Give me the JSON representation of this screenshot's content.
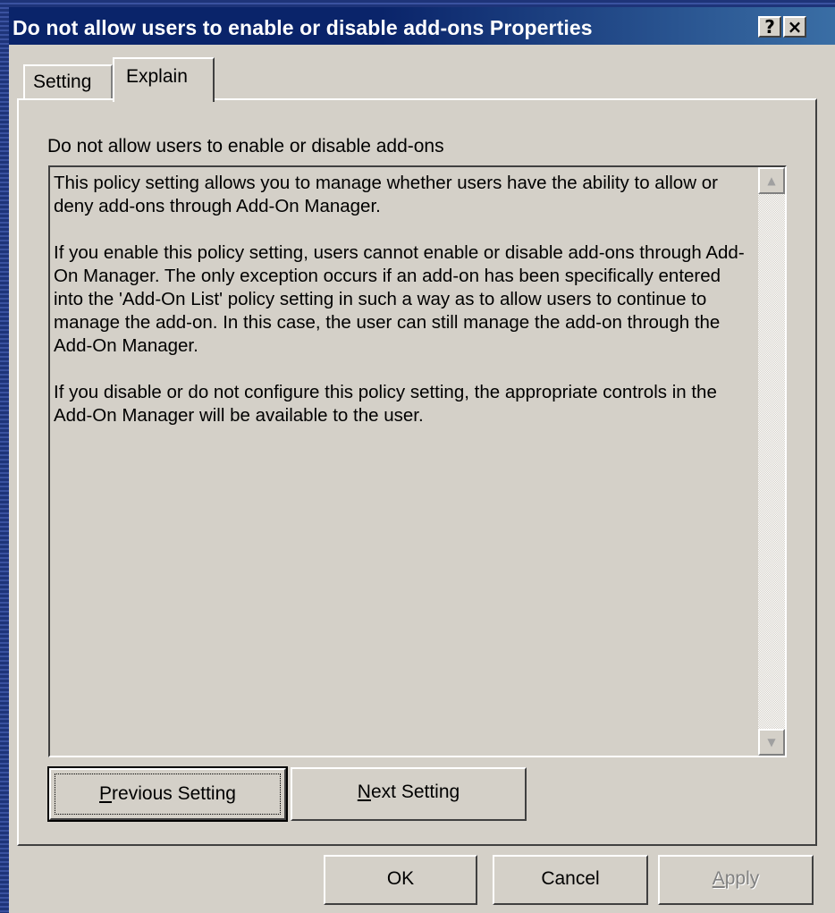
{
  "window": {
    "title": "Do not allow users to enable or disable add-ons Properties",
    "help_button": "?",
    "close_button": "×"
  },
  "tabs": [
    {
      "label": "Setting",
      "selected": false
    },
    {
      "label": "Explain",
      "selected": true
    }
  ],
  "explain": {
    "heading": "Do not allow users to enable or disable add-ons",
    "paragraphs": [
      "This policy setting allows you to manage whether users have the ability to allow or deny add-ons through Add-On Manager.",
      "If you enable this policy setting, users cannot enable or disable add-ons through Add-On Manager. The only exception occurs if an add-on has been specifically entered into the 'Add-On List' policy setting in such a way as to allow users to continue to manage the add-on. In this case, the user can still manage the add-on through the Add-On Manager.",
      "If you disable or do not configure this policy setting, the appropriate controls in the Add-On Manager will be available to the user."
    ]
  },
  "buttons": {
    "previous_setting": {
      "mnemonic": "P",
      "rest": "revious Setting"
    },
    "next_setting": {
      "mnemonic": "N",
      "rest": "ext Setting"
    },
    "ok": "OK",
    "cancel": "Cancel",
    "apply": {
      "mnemonic": "A",
      "rest": "pply",
      "enabled": false
    }
  },
  "icons": {
    "scroll_up": "scroll-up-arrow-icon",
    "scroll_down": "scroll-down-arrow-icon"
  }
}
